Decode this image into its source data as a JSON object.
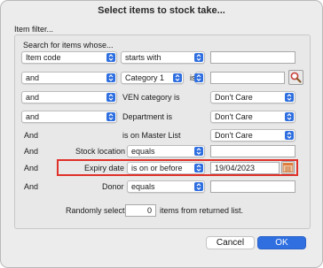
{
  "dialog": {
    "title": "Select items to stock take..."
  },
  "filter": {
    "group_label": "Item filter...",
    "search_label": "Search for items whose...",
    "row1": {
      "field": "Item code",
      "operator": "starts with",
      "value": ""
    },
    "row2": {
      "join": "and",
      "field": "Category 1",
      "is_label": "is",
      "value": ""
    },
    "row3": {
      "join": "and",
      "label": "VEN category is",
      "value": "Don't Care"
    },
    "row4": {
      "join": "and",
      "label": "Department is",
      "value": "Don't Care"
    },
    "row5": {
      "join": "And",
      "label": "is on Master List",
      "value": "Don't Care"
    },
    "row6": {
      "join": "And",
      "label": "Stock location",
      "operator": "equals",
      "value": ""
    },
    "row7": {
      "join": "And",
      "label": "Expiry date",
      "operator": "is on or before",
      "value": "19/04/2023"
    },
    "row8": {
      "join": "And",
      "label": "Donor",
      "operator": "equals",
      "value": ""
    },
    "random": {
      "prefix": "Randomly select",
      "count": "0",
      "suffix": "items from returned list."
    }
  },
  "buttons": {
    "cancel": "Cancel",
    "ok": "OK"
  },
  "colors": {
    "accent": "#2f6fe0",
    "highlight": "#e0312a",
    "search_icon": "#d9534f",
    "calendar_icon": "#e07b39"
  },
  "icons": {
    "search": "magnifier-icon",
    "calendar": "calendar-icon"
  }
}
